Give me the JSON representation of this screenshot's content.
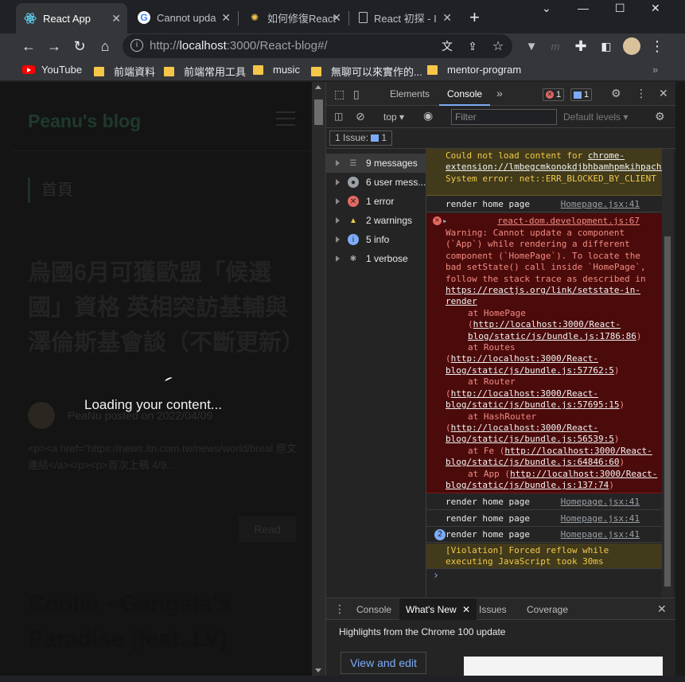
{
  "tabs": [
    {
      "title": "React App",
      "icon": "react-icon",
      "active": true
    },
    {
      "title": "Cannot upda",
      "icon": "google-icon"
    },
    {
      "title": "如何修復React",
      "icon": "react-icon"
    },
    {
      "title": "React 初探 - I",
      "icon": "document-icon"
    }
  ],
  "address": {
    "scheme": "http://",
    "host": "localhost",
    "rest": ":3000/React-blog#/"
  },
  "bookmarks": [
    "YouTube",
    "前端資料",
    "前端常用工具",
    "music",
    "無聊可以來實作的...",
    "mentor-program"
  ],
  "page": {
    "site_title": "Peanu's blog",
    "breadcrumb": "首頁",
    "post1_title": "烏國6月可獲歐盟「候選國」資格 英相突訪基輔與澤倫斯基會談（不斷更新）",
    "post1_meta": "PeaNu posted on 2022/04/09",
    "post1_excerpt": "<p><a href=\"https://news.ltn.com.tw/news/world/breal 原文連結</a></p><p>首次上稿 4/9...",
    "read_button": "Read",
    "post2_title": "Coolio - Gangsta's Paradise (feat. LV)",
    "loading_text": "Loading your content..."
  },
  "devtools": {
    "tabs": [
      "Elements",
      "Console"
    ],
    "active_tab": "Console",
    "error_count": "1",
    "message_count": "1",
    "context": "top",
    "filter_placeholder": "Filter",
    "levels": "Default levels",
    "issues_label": "1 Issue:",
    "issues_count": "1",
    "sidebar": [
      {
        "label": "9 messages",
        "icon": "list-icon"
      },
      {
        "label": "6 user mess...",
        "icon": "user-icon"
      },
      {
        "label": "1 error",
        "icon": "error-icon"
      },
      {
        "label": "2 warnings",
        "icon": "warning-icon"
      },
      {
        "label": "5 info",
        "icon": "info-icon"
      },
      {
        "label": "1 verbose",
        "icon": "bug-icon"
      }
    ],
    "log": {
      "warn1_prefix": "Could not load content for ",
      "warn1_link": "chrome-extension://lmbegcmkonokdjbhbamhpmkihpachdbk/content.js.map",
      "warn1_suffix": ": System error: net::ERR_BLOCKED_BY_CLIENT",
      "render_text": "render home page",
      "render_src": "Homepage.jsx:41",
      "error_src": "react-dom.development.js:67",
      "error_text": "Warning: Cannot update a component (`App`) while rendering a different component (`HomePage`). To locate the bad setState() call inside `HomePage`, follow the stack trace as described in ",
      "error_link": "https://reactjs.org/link/setstate-in-render",
      "stack": [
        {
          "fn": "at HomePage",
          "url": "http://localhost:3000/React-blog/static/js/bundle.js:1786:86"
        },
        {
          "fn": "at Routes",
          "url": "http://localhost:3000/React-blog/static/js/bundle.js:57762:5"
        },
        {
          "fn": "at Router",
          "url": "http://localhost:3000/React-blog/static/js/bundle.js:57695:15"
        },
        {
          "fn": "at HashRouter",
          "url": "http://localhost:3000/React-blog/static/js/bundle.js:56539:5"
        },
        {
          "fn": "at Fe",
          "url": "http://localhost:3000/React-blog/static/js/bundle.js:64846:60"
        },
        {
          "fn": "at App",
          "url": "http://localhost:3000/React-blog/static/js/bundle.js:137:74"
        }
      ],
      "repeat_count": "2",
      "violation": "[Violation] Forced reflow while executing JavaScript took 30ms"
    },
    "drawer_tabs": [
      "Console",
      "What's New",
      "Issues",
      "Coverage"
    ],
    "drawer_active": "What's New",
    "highlights": "Highlights from the Chrome 100 update",
    "view_edit": "View and edit"
  },
  "colors": {
    "error": "#e46962",
    "warning": "#f2c94c",
    "link": "#7cacf8"
  }
}
